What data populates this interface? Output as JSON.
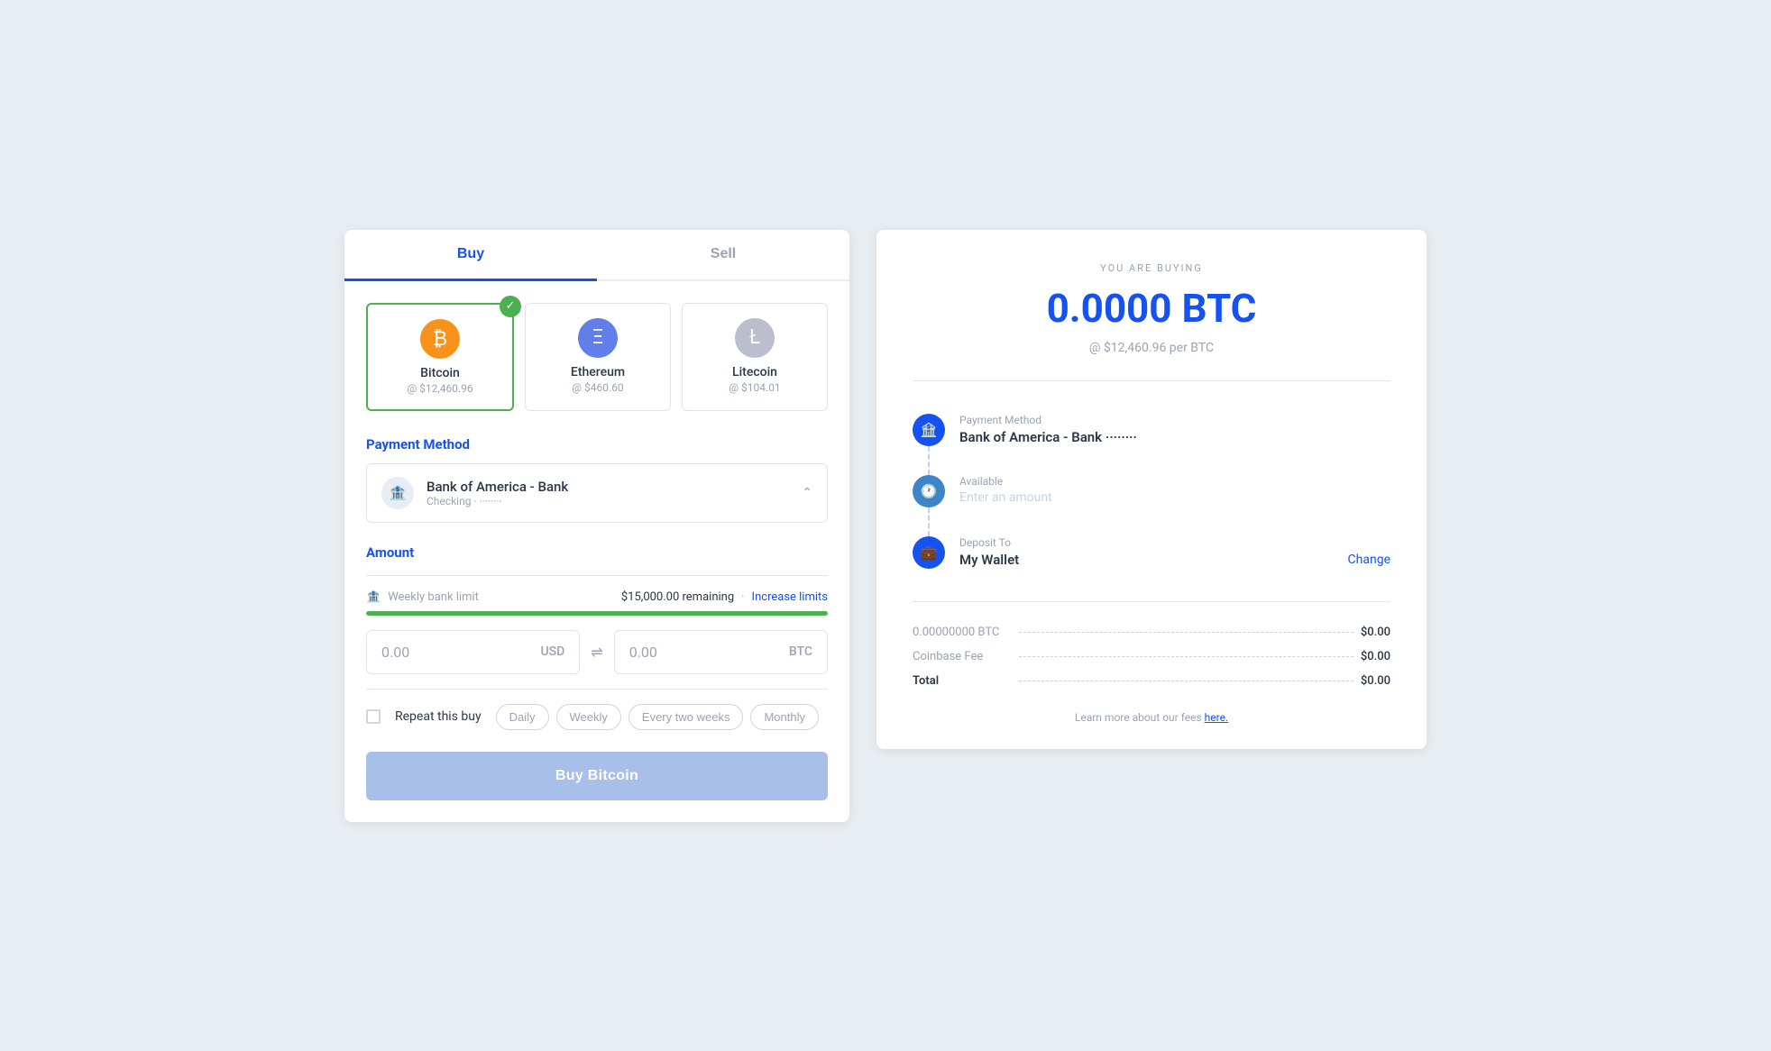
{
  "tabs": {
    "buy": "Buy",
    "sell": "Sell"
  },
  "crypto": {
    "options": [
      {
        "id": "btc",
        "name": "Bitcoin",
        "price": "@ $12,460.96",
        "selected": true,
        "symbol": "₿"
      },
      {
        "id": "eth",
        "name": "Ethereum",
        "price": "@ $460.60",
        "selected": false,
        "symbol": "Ξ"
      },
      {
        "id": "ltc",
        "name": "Litecoin",
        "price": "@ $104.01",
        "selected": false,
        "symbol": "Ł"
      }
    ]
  },
  "payment": {
    "section_title": "Payment Method",
    "bank_name": "Bank of America - Bank",
    "account_type": "Checking · ········"
  },
  "amount": {
    "section_title": "Amount",
    "limit_label": "Weekly bank limit",
    "limit_remaining": "$15,000.00 remaining",
    "limit_separator": "·",
    "increase_link": "Increase limits",
    "progress_percent": 100,
    "usd_value": "0.00",
    "usd_currency": "USD",
    "btc_value": "0.00",
    "btc_currency": "BTC"
  },
  "repeat": {
    "label": "Repeat this buy",
    "frequencies": [
      "Daily",
      "Weekly",
      "Every two weeks",
      "Monthly"
    ]
  },
  "buy_button": "Buy Bitcoin",
  "summary": {
    "buying_label": "YOU ARE BUYING",
    "btc_amount": "0.0000 BTC",
    "rate": "@ $12,460.96 per BTC",
    "payment_method_label": "Payment Method",
    "payment_method_value": "Bank of America - Bank ········",
    "available_label": "Available",
    "available_placeholder": "Enter an amount",
    "deposit_label": "Deposit To",
    "deposit_value": "My Wallet",
    "change_link": "Change",
    "fee_rows": [
      {
        "name": "0.00000000 BTC",
        "value": "$0.00"
      },
      {
        "name": "Coinbase Fee",
        "value": "$0.00"
      },
      {
        "name": "Total",
        "value": "$0.00"
      }
    ],
    "learn_more": "Learn more about our fees",
    "here": "here."
  }
}
